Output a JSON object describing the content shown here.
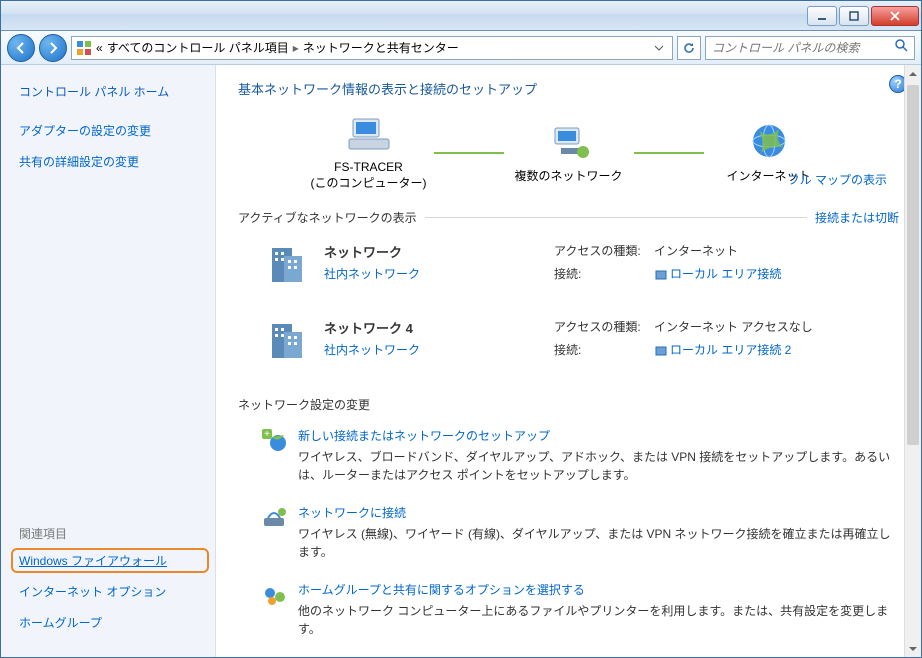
{
  "titlebar": {},
  "nav": {
    "crumb_prefix": "«",
    "crumb1": "すべてのコントロール パネル項目",
    "crumb2": "ネットワークと共有センター",
    "search_placeholder": "コントロール パネルの検索"
  },
  "sidebar": {
    "home": "コントロール パネル ホーム",
    "links": [
      "アダプターの設定の変更",
      "共有の詳細設定の変更"
    ],
    "related_header": "関連項目",
    "related": [
      "Windows ファイアウォール",
      "インターネット オプション",
      "ホームグループ"
    ]
  },
  "main": {
    "heading": "基本ネットワーク情報の表示と接続のセットアップ",
    "map": {
      "node1": "FS-TRACER",
      "node1_sub": "(このコンピューター)",
      "node2": "複数のネットワーク",
      "node3": "インターネット",
      "full_map": "フル マップの表示"
    },
    "active_header": "アクティブなネットワークの表示",
    "active_link": "接続または切断",
    "networks": [
      {
        "name": "ネットワーク",
        "type": "社内ネットワーク",
        "access_label": "アクセスの種類:",
        "access_value": "インターネット",
        "conn_label": "接続:",
        "conn_value": "ローカル エリア接続"
      },
      {
        "name": "ネットワーク 4",
        "type": "社内ネットワーク",
        "access_label": "アクセスの種類:",
        "access_value": "インターネット アクセスなし",
        "conn_label": "接続:",
        "conn_value": "ローカル エリア接続 2"
      }
    ],
    "settings_header": "ネットワーク設定の変更",
    "settings": [
      {
        "title": "新しい接続またはネットワークのセットアップ",
        "desc": "ワイヤレス、ブロードバンド、ダイヤルアップ、アドホック、または VPN 接続をセットアップします。あるいは、ルーターまたはアクセス ポイントをセットアップします。"
      },
      {
        "title": "ネットワークに接続",
        "desc": "ワイヤレス (無線)、ワイヤード (有線)、ダイヤルアップ、または VPN ネットワーク接続を確立または再確立します。"
      },
      {
        "title": "ホームグループと共有に関するオプションを選択する",
        "desc": "他のネットワーク コンピューター上にあるファイルやプリンターを利用します。または、共有設定を変更します。"
      }
    ]
  }
}
